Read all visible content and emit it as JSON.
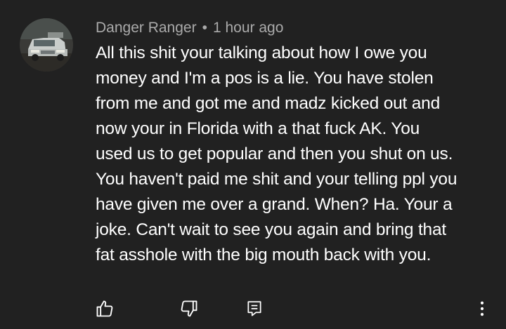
{
  "comment": {
    "author": "Danger Ranger",
    "separator": "•",
    "time": "1 hour ago",
    "lines": [
      "All this shit your talking about how I owe you",
      "money and I'm a pos is a lie. You have stolen",
      "from me and got me and madz kicked out and",
      "now your in Florida with a that fuck AK. You",
      "used us to get popular and then you shut on us.",
      "You haven't paid me shit and your telling ppl you",
      "have given me over a grand. When? Ha. Your a",
      "joke. Can't wait to see you again and bring that",
      "fat asshole with the big mouth back with you."
    ]
  },
  "actions": {
    "like_icon": "thumb-up-icon",
    "dislike_icon": "thumb-down-icon",
    "reply_icon": "reply-comment-icon",
    "more_icon": "more-vertical-icon"
  },
  "colors": {
    "background": "#212121",
    "text": "#ffffff",
    "meta": "#aaaaaa"
  }
}
